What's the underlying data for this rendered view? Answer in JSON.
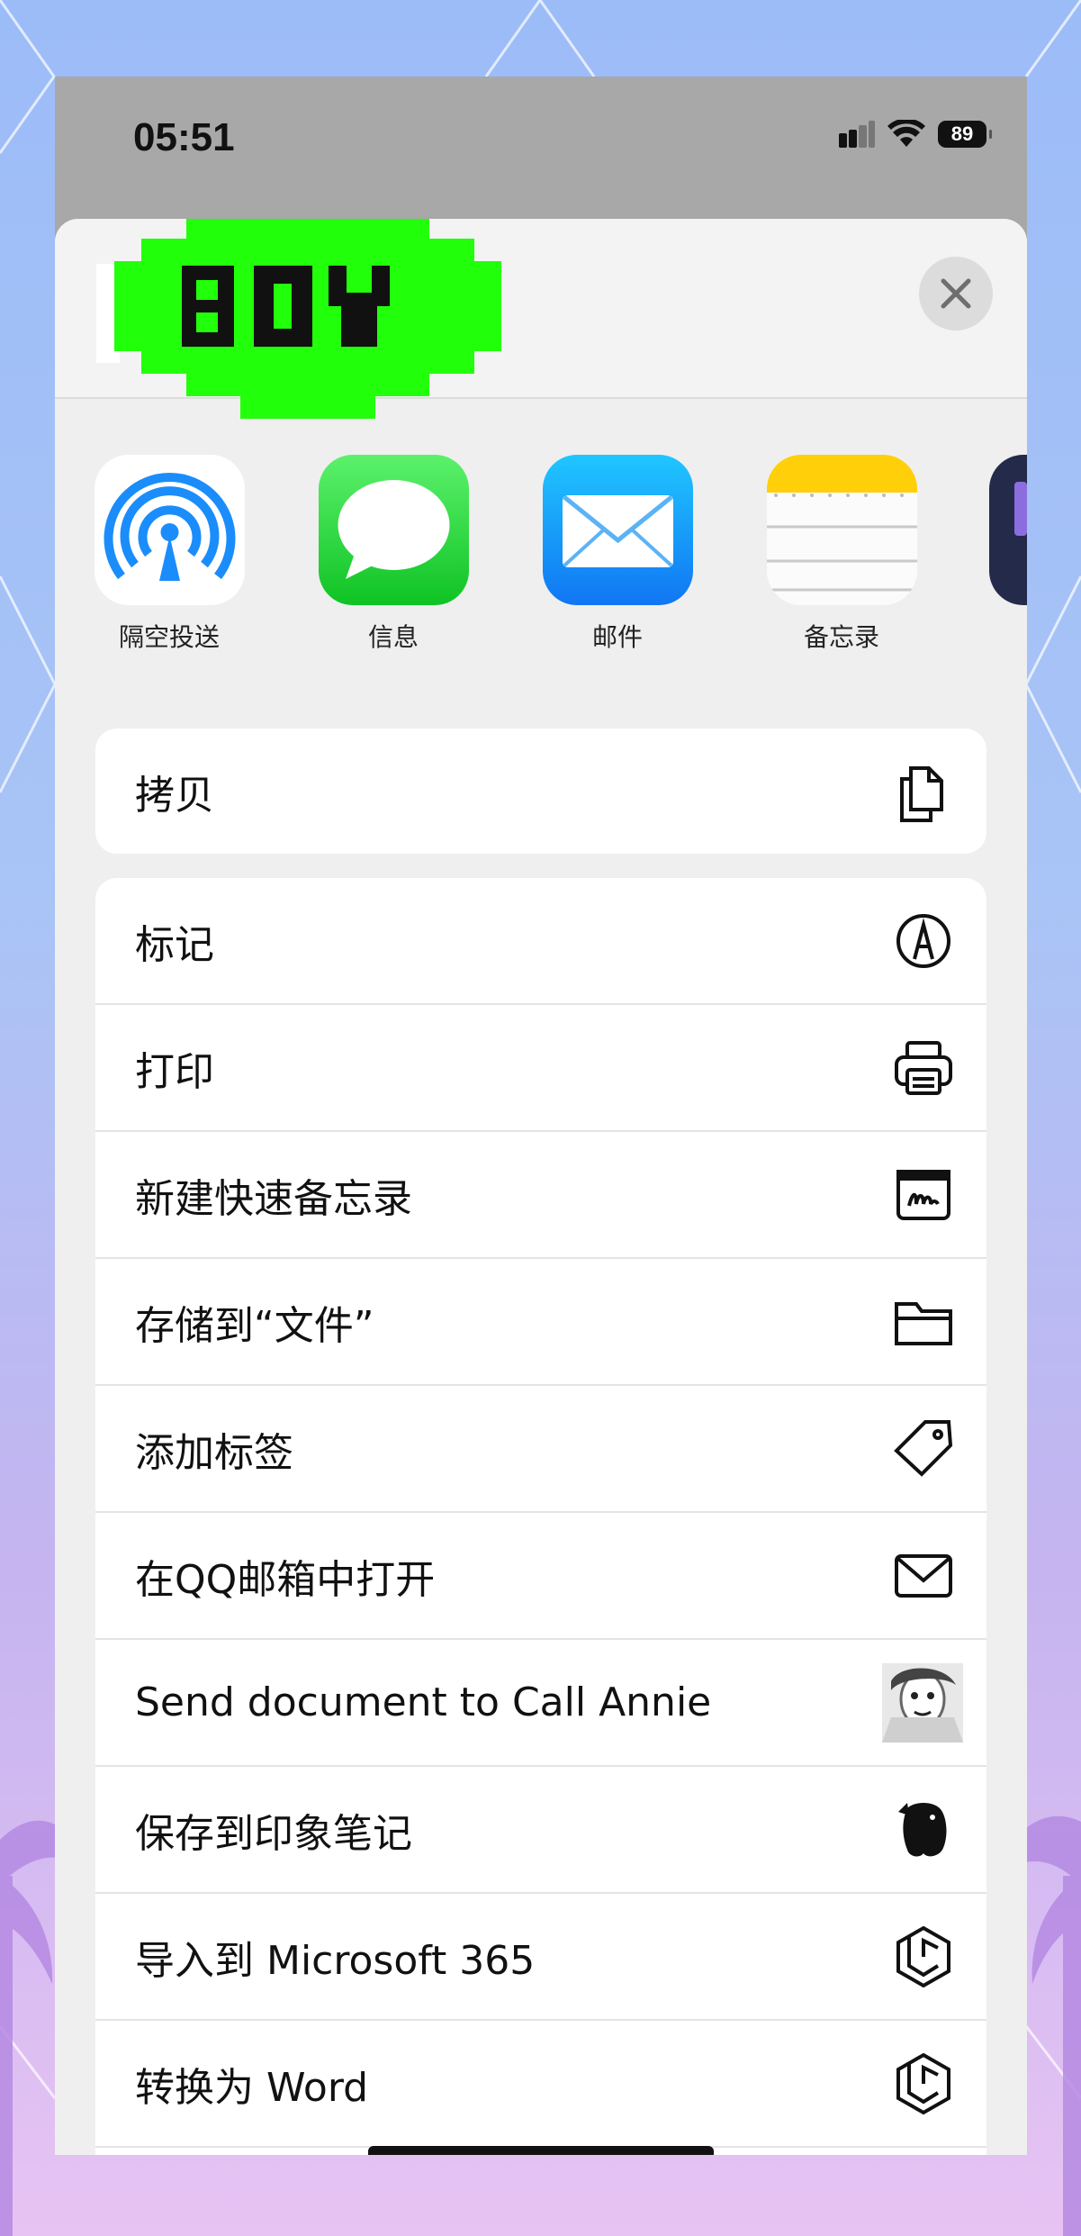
{
  "status_bar": {
    "time": "05:51",
    "battery": "89"
  },
  "header": {
    "close_icon": "xmark-icon",
    "logo_text": "BOY"
  },
  "apps": [
    {
      "label": "隔空投送",
      "icon": "airdrop-icon"
    },
    {
      "label": "信息",
      "icon": "messages-icon"
    },
    {
      "label": "邮件",
      "icon": "mail-icon"
    },
    {
      "label": "备忘录",
      "icon": "notes-icon"
    }
  ],
  "copy_group": [
    {
      "label": "拷贝",
      "icon": "copy-icon"
    }
  ],
  "actions": [
    {
      "label": "标记",
      "icon": "markup-icon"
    },
    {
      "label": "打印",
      "icon": "printer-icon"
    },
    {
      "label": "新建快速备忘录",
      "icon": "quick-note-icon"
    },
    {
      "label": "存储到“文件”",
      "icon": "folder-icon"
    },
    {
      "label": "添加标签",
      "icon": "tag-icon"
    },
    {
      "label": "在QQ邮箱中打开",
      "icon": "envelope-icon"
    },
    {
      "label": "Send document to Call Annie",
      "icon": "call-annie-icon"
    },
    {
      "label": "保存到印象笔记",
      "icon": "evernote-icon"
    },
    {
      "label": "导入到 Microsoft 365",
      "icon": "microsoft365-icon"
    },
    {
      "label": "转换为 Word",
      "icon": "microsoft365-icon"
    }
  ]
}
